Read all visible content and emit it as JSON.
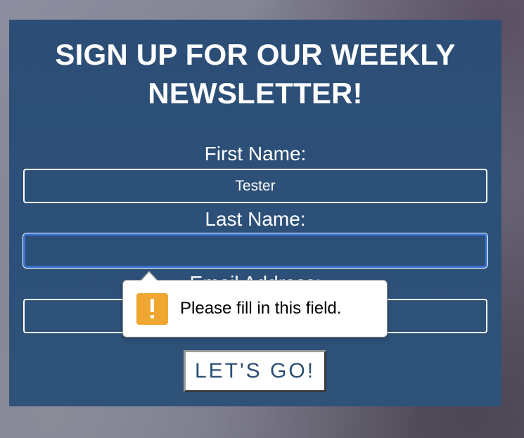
{
  "form": {
    "title_line1": "SIGN UP FOR OUR WEEKLY",
    "title_line2": "NEWSLETTER!",
    "first_name_label": "First Name:",
    "first_name_value": "Tester",
    "last_name_label": "Last Name:",
    "last_name_value": "",
    "email_label": "Email Address:",
    "email_value": "",
    "submit_label": "LET'S GO!"
  },
  "validation": {
    "message": "Please fill in this field.",
    "icon": "warning-icon",
    "icon_color": "#f0a732"
  },
  "colors": {
    "panel": "#2c4e76",
    "focus_ring": "#3d74d6"
  }
}
